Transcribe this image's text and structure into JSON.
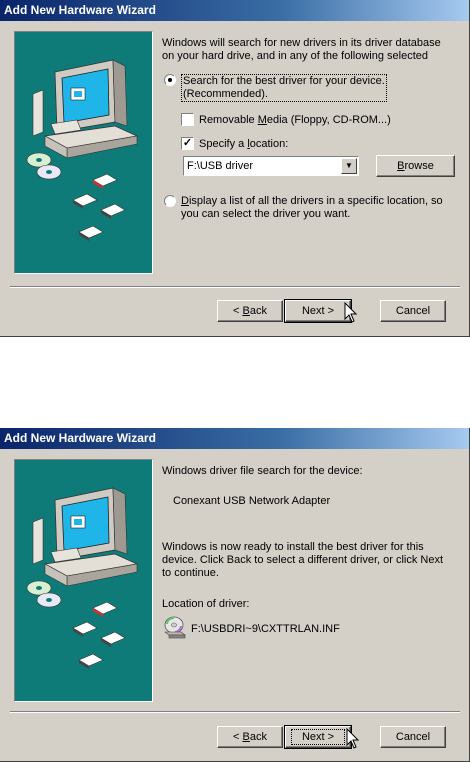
{
  "screen1": {
    "title": "Add New Hardware Wizard",
    "intro_line1": "Windows will search for new drivers in its driver database",
    "intro_line2": "on your hard drive, and in any of the following selected",
    "option_search_line1": "Search for the best driver for your device.",
    "option_search_line2": "(Recommended).",
    "removable_media": {
      "pre": "Removable ",
      "key": "M",
      "post": "edia (Floppy, CD-ROM...)"
    },
    "specify_location": {
      "pre": "Specify a ",
      "key": "l",
      "post": "ocation:"
    },
    "location_value": "F:\\USB driver",
    "browse": {
      "key": "B",
      "post": "rowse"
    },
    "option_display_line1": {
      "key": "D",
      "post": "isplay a list of all the drivers in a specific location, so"
    },
    "option_display_line2": "you can select the driver you want.",
    "back": {
      "pre": "< ",
      "key": "B",
      "post": "ack"
    },
    "next": "Next >",
    "cancel": "Cancel",
    "search_selected": true,
    "removable_checked": false,
    "specify_checked": true
  },
  "screen2": {
    "title": "Add New Hardware Wizard",
    "search_label": "Windows driver file search for the device:",
    "device_name": "Conexant USB Network Adapter",
    "ready_line1": "Windows is now ready to install the best driver for this",
    "ready_line2": "device. Click Back to select a different driver, or click Next",
    "ready_line3": "to continue.",
    "location_label": "Location of driver:",
    "driver_path": "F:\\USBDRI~9\\CXTTRLAN.INF",
    "back": {
      "pre": "< ",
      "key": "B",
      "post": "ack"
    },
    "next": "Next >",
    "cancel": "Cancel"
  }
}
